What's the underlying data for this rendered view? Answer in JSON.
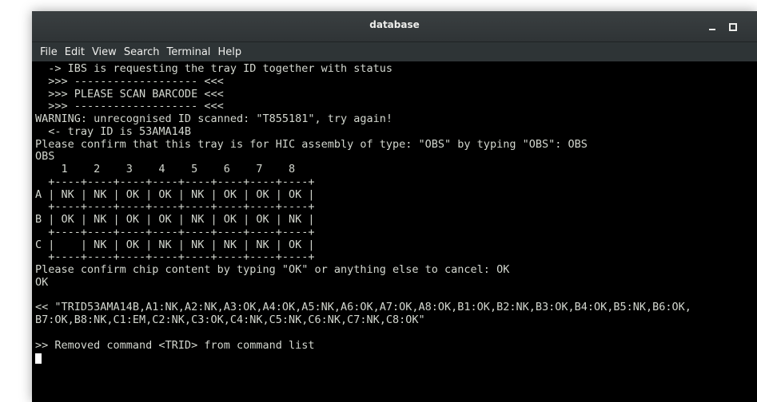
{
  "window": {
    "title": "database"
  },
  "menu": {
    "items": [
      "File",
      "Edit",
      "View",
      "Search",
      "Terminal",
      "Help"
    ]
  },
  "terminal": {
    "lines": [
      "  -> IBS is requesting the tray ID together with status",
      "  >>> ------------------- <<<",
      "  >>> PLEASE SCAN BARCODE <<<",
      "  >>> ------------------- <<<",
      "WARNING: unrecognised ID scanned: \"T855181\", try again!",
      "  <- tray ID is 53AMA14B",
      "Please confirm that this tray is for HIC assembly of type: \"OBS\" by typing \"OBS\": OBS",
      "OBS",
      "    1    2    3    4    5    6    7    8",
      "  +----+----+----+----+----+----+----+----+",
      "A | NK | NK | OK | OK | NK | OK | OK | OK |",
      "  +----+----+----+----+----+----+----+----+",
      "B | OK | NK | OK | OK | NK | OK | OK | NK |",
      "  +----+----+----+----+----+----+----+----+",
      "C |    | NK | OK | NK | NK | NK | NK | OK |",
      "  +----+----+----+----+----+----+----+----+",
      "Please confirm chip content by typing \"OK\" or anything else to cancel: OK",
      "OK",
      "",
      "<< \"TRID53AMA14B,A1:NK,A2:NK,A3:OK,A4:OK,A5:NK,A6:OK,A7:OK,A8:OK,B1:OK,B2:NK,B3:OK,B4:OK,B5:NK,B6:OK,",
      "B7:OK,B8:NK,C1:EM,C2:NK,C3:OK,C4:NK,C5:NK,C6:NK,C7:NK,C8:OK\"",
      "",
      ">> Removed command <TRID> from command list"
    ]
  }
}
